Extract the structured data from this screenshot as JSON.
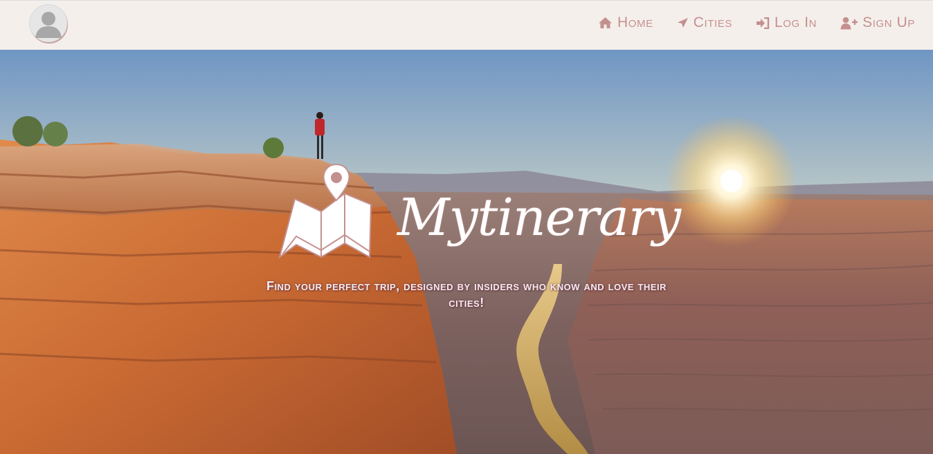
{
  "navbar": {
    "avatar_icon": "user-avatar-icon",
    "items": [
      {
        "label": "Home",
        "icon": "home-icon"
      },
      {
        "label": "Cities",
        "icon": "paper-plane-icon"
      },
      {
        "label": "Log In",
        "icon": "sign-in-icon"
      },
      {
        "label": "Sign Up",
        "icon": "user-plus-icon"
      }
    ]
  },
  "hero": {
    "brand": "Mytinerary",
    "logo_icon": "folded-map-pin-icon",
    "tagline": "Find your perfect trip, designed by insiders who know and love their cities!"
  },
  "colors": {
    "navbar_bg": "#f5efeb",
    "nav_text": "#c4908f",
    "tagline_text": "#f4ecf0"
  }
}
